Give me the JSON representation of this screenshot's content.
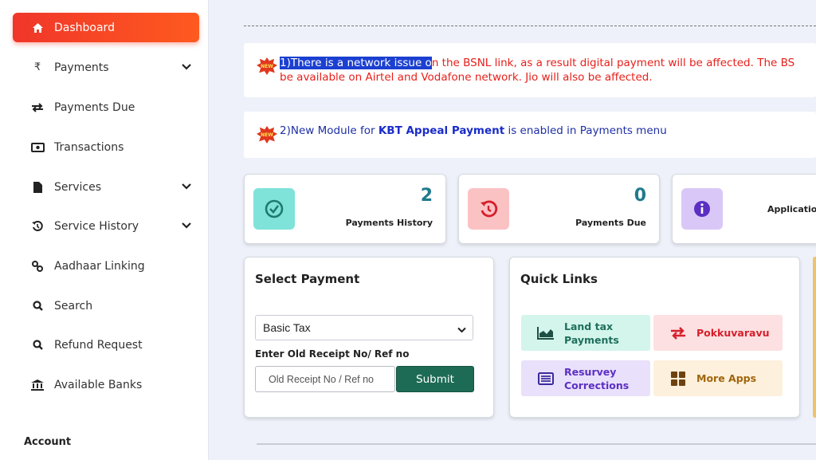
{
  "sidebar": {
    "items": [
      {
        "label": "Dashboard",
        "icon": "home-icon"
      },
      {
        "label": "Payments",
        "icon": "rupee-icon"
      },
      {
        "label": "Payments Due",
        "icon": "swap-icon"
      },
      {
        "label": "Transactions",
        "icon": "money-icon"
      },
      {
        "label": "Services",
        "icon": "file-icon"
      },
      {
        "label": "Service History",
        "icon": "history-icon"
      },
      {
        "label": "Aadhaar Linking",
        "icon": "link-icon"
      },
      {
        "label": "Search",
        "icon": "search-icon"
      },
      {
        "label": "Refund Request",
        "icon": "search-icon"
      },
      {
        "label": "Available Banks",
        "icon": "bank-icon"
      }
    ],
    "account_label": "Account"
  },
  "notices": {
    "badge": "NEW",
    "n1_highlighted": "1)There is a network issue o",
    "n1_rest": "n the BSNL link, as a result digital payment will be affected. The BS",
    "n1_line2": "be available on Airtel and Vodafone network. Jio will also be affected.",
    "n2_prefix": "2)New Module for ",
    "n2_bold": "KBT Appeal Payment",
    "n2_suffix": " is enabled in Payments menu"
  },
  "stats": [
    {
      "value": "2",
      "label": "Payments History"
    },
    {
      "value": "0",
      "label": "Payments Due"
    },
    {
      "value": "",
      "label": "Applicatio"
    }
  ],
  "select_payment": {
    "title": "Select Payment",
    "selected": "Basic Tax",
    "receipt_label": "Enter Old Receipt No/ Ref no",
    "receipt_placeholder": "Old Receipt No / Ref no",
    "submit": "Submit"
  },
  "quick_links": {
    "title": "Quick Links",
    "items": [
      {
        "line1": "Land tax",
        "line2": "Payments"
      },
      {
        "line1": "Pokkuvaravu",
        "line2": ""
      },
      {
        "line1": "Resurvey",
        "line2": "Corrections"
      },
      {
        "line1": "More Apps",
        "line2": ""
      }
    ]
  },
  "colors": {
    "accent": "#f0362a",
    "notice_red": "#e8201b",
    "notice_blue": "#1e2fa5",
    "submit_green": "#1e6b55"
  }
}
